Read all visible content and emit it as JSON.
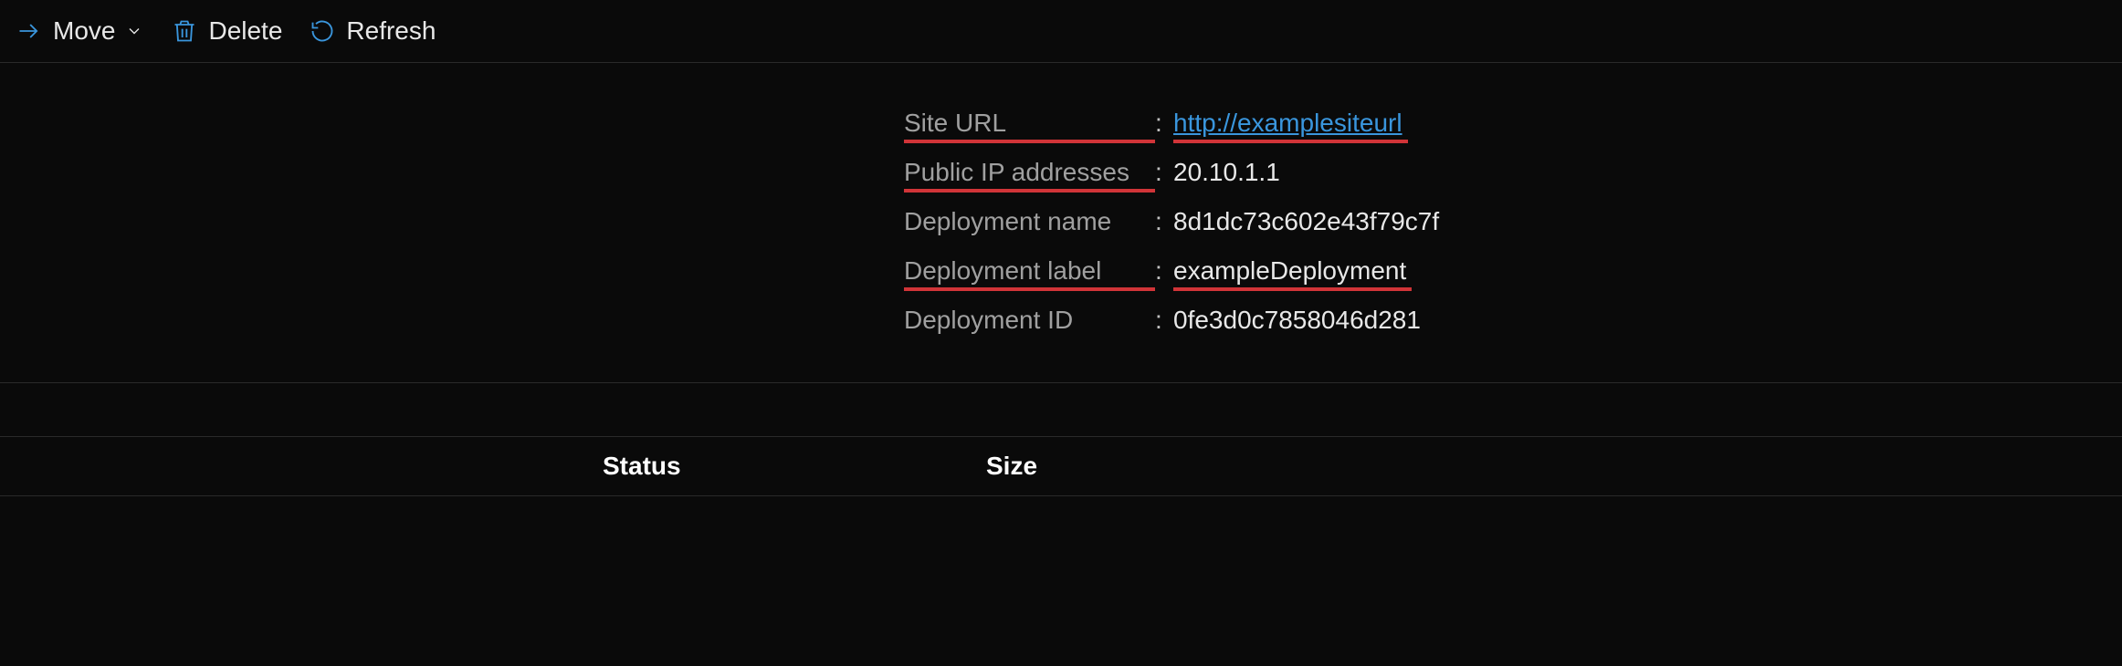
{
  "toolbar": {
    "move_label": "Move",
    "delete_label": "Delete",
    "refresh_label": "Refresh"
  },
  "properties": {
    "site_url": {
      "label": "Site URL",
      "value": "http://examplesiteurl"
    },
    "public_ip": {
      "label": "Public IP addresses",
      "value": "20.10.1.1"
    },
    "deployment_name": {
      "label": "Deployment name",
      "value": "8d1dc73c602e43f79c7f"
    },
    "deployment_label": {
      "label": "Deployment label",
      "value": "exampleDeployment"
    },
    "deployment_id": {
      "label": "Deployment ID",
      "value": "0fe3d0c7858046d281"
    }
  },
  "table": {
    "col_status": "Status",
    "col_size": "Size"
  }
}
